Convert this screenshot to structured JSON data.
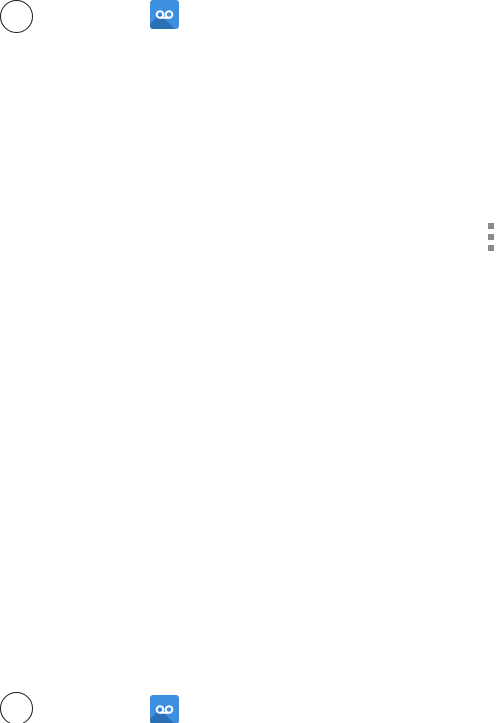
{
  "icons": {
    "top_radio": "radio-button-unselected",
    "top_app": "voicemail-app-icon",
    "overflow": "vertical-dots-menu",
    "bottom_radio": "radio-button-unselected",
    "bottom_app": "voicemail-app-icon"
  },
  "colors": {
    "app_icon_background": "#3d8fe0",
    "app_icon_shadow": "#2b6fb5",
    "menu_dots": "#8a8a8a"
  }
}
